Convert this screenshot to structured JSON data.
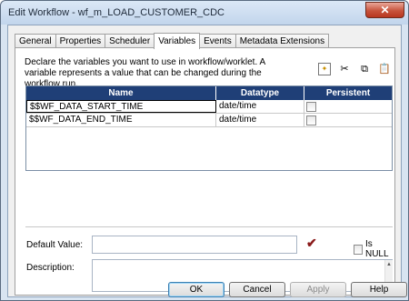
{
  "window": {
    "title": "Edit Workflow - wf_m_LOAD_CUSTOMER_CDC",
    "close_symbol": "✕"
  },
  "tabs": [
    {
      "label": "General"
    },
    {
      "label": "Properties"
    },
    {
      "label": "Scheduler"
    },
    {
      "label": "Variables",
      "active": true
    },
    {
      "label": "Events"
    },
    {
      "label": "Metadata Extensions"
    }
  ],
  "variables_tab": {
    "description": "Declare the variables you want to use in workflow/worklet.  A variable represents a value that can be changed during the workflow run.",
    "toolbar": {
      "new_icon": "new-variable-icon",
      "cut_icon": "cut-icon",
      "copy_icon": "copy-icon",
      "paste_icon": "paste-icon"
    },
    "columns": [
      "Name",
      "Datatype",
      "Persistent"
    ],
    "rows": [
      {
        "name": "$$WF_DATA_START_TIME",
        "datatype": "date/time",
        "persistent": false
      },
      {
        "name": "$$WF_DATA_END_TIME",
        "datatype": "date/time",
        "persistent": false
      }
    ],
    "default_value": {
      "label": "Default Value:",
      "value": ""
    },
    "is_null": {
      "label": "Is NULL",
      "checked": false
    },
    "description_field": {
      "label": "Description:",
      "value": ""
    }
  },
  "buttons": {
    "ok": "OK",
    "cancel": "Cancel",
    "apply": "Apply",
    "help": "Help"
  },
  "colors": {
    "grid_header": "#1f3f77",
    "title_bar": "#c2d5ec",
    "close_button": "#c7533c"
  }
}
